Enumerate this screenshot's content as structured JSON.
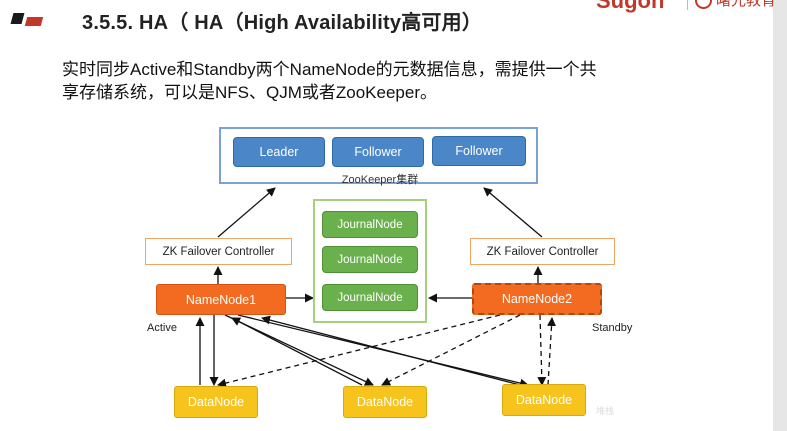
{
  "header": {
    "title": "3.5.5. HA（ HA（High Availability高可用）",
    "brand_name": "Sugon",
    "brand_cn": "曙光教育"
  },
  "description": {
    "line1": "实时同步Active和Standby两个NameNode的元数据信息，需提供一个共",
    "line2": "享存储系统，可以是NFS、QJM或者ZooKeeper。"
  },
  "diagram": {
    "zookeeper": {
      "nodes": [
        "Leader",
        "Follower",
        "Follower"
      ],
      "caption": "ZooKeeper集群"
    },
    "journal_nodes": [
      "JournalNode",
      "JournalNode",
      "JournalNode"
    ],
    "zkfc_left": "ZK Failover Controller",
    "zkfc_right": "ZK Failover Controller",
    "namenode_active": "NameNode1",
    "namenode_standby": "NameNode2",
    "role_active": "Active",
    "role_standby": "Standby",
    "datanodes": [
      "DataNode",
      "DataNode",
      "DataNode"
    ],
    "watermark": "堆栈"
  },
  "colors": {
    "accent": "#c0392b",
    "zookeeper_blue": "#4a86c8",
    "journal_green": "#6ab04c",
    "namenode_orange": "#f26b21",
    "datanode_yellow": "#f7c31d"
  }
}
